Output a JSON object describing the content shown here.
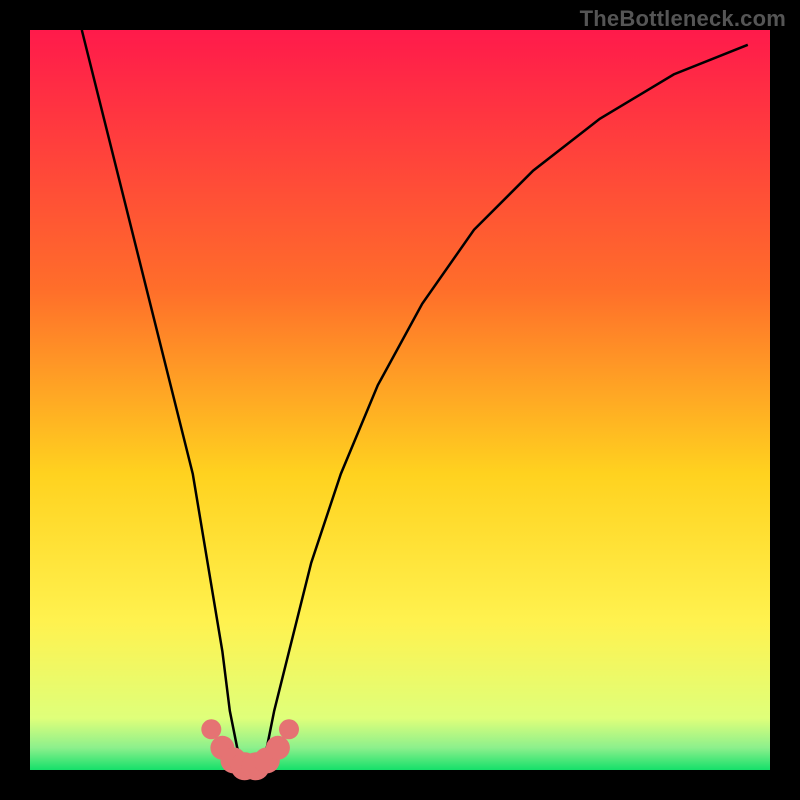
{
  "watermark": "TheBottleneck.com",
  "chart_data": {
    "type": "line",
    "title": "",
    "xlabel": "",
    "ylabel": "",
    "xlim": [
      0,
      100
    ],
    "ylim": [
      0,
      100
    ],
    "grid": false,
    "legend": false,
    "background_gradient": {
      "stops": [
        {
          "offset": 0.0,
          "color": "#ff1a4b"
        },
        {
          "offset": 0.35,
          "color": "#ff6e2a"
        },
        {
          "offset": 0.6,
          "color": "#ffd21f"
        },
        {
          "offset": 0.8,
          "color": "#fff24f"
        },
        {
          "offset": 0.93,
          "color": "#dfff7a"
        },
        {
          "offset": 0.97,
          "color": "#8cf08c"
        },
        {
          "offset": 1.0,
          "color": "#15e06a"
        }
      ]
    },
    "series": [
      {
        "name": "bottleneck-curve",
        "x": [
          7,
          10,
          13,
          16,
          19,
          22,
          24,
          26,
          27,
          28,
          29,
          30,
          31,
          32,
          33,
          35,
          38,
          42,
          47,
          53,
          60,
          68,
          77,
          87,
          97
        ],
        "values": [
          100,
          88,
          76,
          64,
          52,
          40,
          28,
          16,
          8,
          3,
          1,
          0,
          1,
          3,
          8,
          16,
          28,
          40,
          52,
          63,
          73,
          81,
          88,
          94,
          98
        ]
      }
    ],
    "markers": {
      "name": "highlight-points",
      "color": "#e57373",
      "x": [
        24.5,
        26.0,
        27.5,
        29.0,
        30.5,
        32.0,
        33.5,
        35.0
      ],
      "values": [
        5.5,
        3.0,
        1.3,
        0.5,
        0.5,
        1.3,
        3.0,
        5.5
      ],
      "radius": [
        10,
        12,
        13,
        14,
        14,
        13,
        12,
        10
      ]
    }
  }
}
